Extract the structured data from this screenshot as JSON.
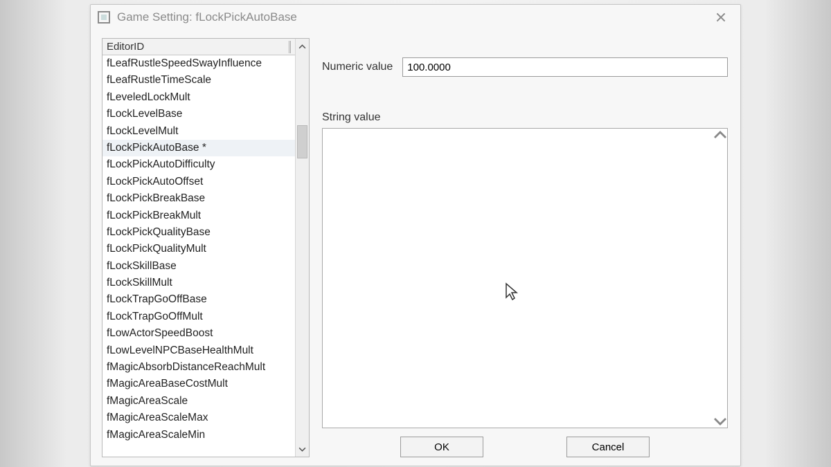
{
  "window": {
    "title": "Game Setting: fLockPickAutoBase"
  },
  "list": {
    "header": "EditorID",
    "items": [
      "fLeafRustleSpeedSwayInfluence",
      "fLeafRustleTimeScale",
      "fLeveledLockMult",
      "fLockLevelBase",
      "fLockLevelMult",
      "fLockPickAutoBase *",
      "fLockPickAutoDifficulty",
      "fLockPickAutoOffset",
      "fLockPickBreakBase",
      "fLockPickBreakMult",
      "fLockPickQualityBase",
      "fLockPickQualityMult",
      "fLockSkillBase",
      "fLockSkillMult",
      "fLockTrapGoOffBase",
      "fLockTrapGoOffMult",
      "fLowActorSpeedBoost",
      "fLowLevelNPCBaseHealthMult",
      "fMagicAbsorbDistanceReachMult",
      "fMagicAreaBaseCostMult",
      "fMagicAreaScale",
      "fMagicAreaScaleMax",
      "fMagicAreaScaleMin"
    ],
    "selected_index": 5
  },
  "form": {
    "numeric_label": "Numeric value",
    "numeric_value": "100.0000",
    "string_label": "String value",
    "string_value": ""
  },
  "buttons": {
    "ok": "OK",
    "cancel": "Cancel"
  }
}
